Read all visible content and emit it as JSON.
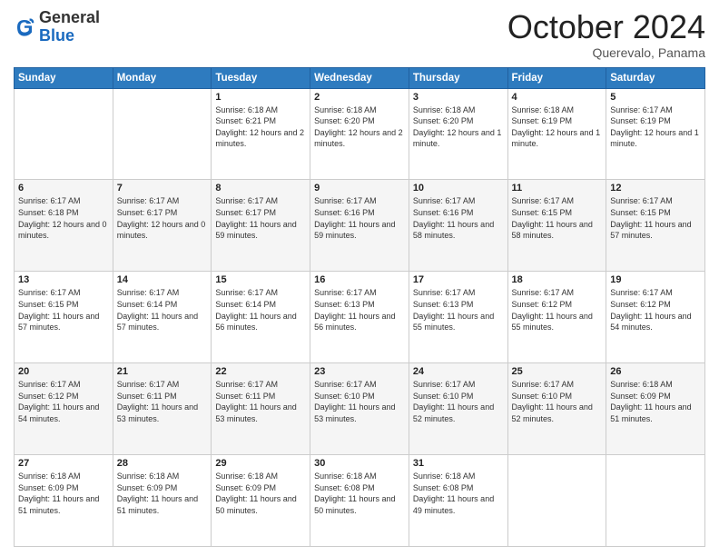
{
  "header": {
    "logo_general": "General",
    "logo_blue": "Blue",
    "month": "October 2024",
    "location": "Querevalo, Panama"
  },
  "days_of_week": [
    "Sunday",
    "Monday",
    "Tuesday",
    "Wednesday",
    "Thursday",
    "Friday",
    "Saturday"
  ],
  "weeks": [
    [
      {
        "day": "",
        "content": ""
      },
      {
        "day": "",
        "content": ""
      },
      {
        "day": "1",
        "content": "Sunrise: 6:18 AM\nSunset: 6:21 PM\nDaylight: 12 hours and 2 minutes."
      },
      {
        "day": "2",
        "content": "Sunrise: 6:18 AM\nSunset: 6:20 PM\nDaylight: 12 hours and 2 minutes."
      },
      {
        "day": "3",
        "content": "Sunrise: 6:18 AM\nSunset: 6:20 PM\nDaylight: 12 hours and 1 minute."
      },
      {
        "day": "4",
        "content": "Sunrise: 6:18 AM\nSunset: 6:19 PM\nDaylight: 12 hours and 1 minute."
      },
      {
        "day": "5",
        "content": "Sunrise: 6:17 AM\nSunset: 6:19 PM\nDaylight: 12 hours and 1 minute."
      }
    ],
    [
      {
        "day": "6",
        "content": "Sunrise: 6:17 AM\nSunset: 6:18 PM\nDaylight: 12 hours and 0 minutes."
      },
      {
        "day": "7",
        "content": "Sunrise: 6:17 AM\nSunset: 6:17 PM\nDaylight: 12 hours and 0 minutes."
      },
      {
        "day": "8",
        "content": "Sunrise: 6:17 AM\nSunset: 6:17 PM\nDaylight: 11 hours and 59 minutes."
      },
      {
        "day": "9",
        "content": "Sunrise: 6:17 AM\nSunset: 6:16 PM\nDaylight: 11 hours and 59 minutes."
      },
      {
        "day": "10",
        "content": "Sunrise: 6:17 AM\nSunset: 6:16 PM\nDaylight: 11 hours and 58 minutes."
      },
      {
        "day": "11",
        "content": "Sunrise: 6:17 AM\nSunset: 6:15 PM\nDaylight: 11 hours and 58 minutes."
      },
      {
        "day": "12",
        "content": "Sunrise: 6:17 AM\nSunset: 6:15 PM\nDaylight: 11 hours and 57 minutes."
      }
    ],
    [
      {
        "day": "13",
        "content": "Sunrise: 6:17 AM\nSunset: 6:15 PM\nDaylight: 11 hours and 57 minutes."
      },
      {
        "day": "14",
        "content": "Sunrise: 6:17 AM\nSunset: 6:14 PM\nDaylight: 11 hours and 57 minutes."
      },
      {
        "day": "15",
        "content": "Sunrise: 6:17 AM\nSunset: 6:14 PM\nDaylight: 11 hours and 56 minutes."
      },
      {
        "day": "16",
        "content": "Sunrise: 6:17 AM\nSunset: 6:13 PM\nDaylight: 11 hours and 56 minutes."
      },
      {
        "day": "17",
        "content": "Sunrise: 6:17 AM\nSunset: 6:13 PM\nDaylight: 11 hours and 55 minutes."
      },
      {
        "day": "18",
        "content": "Sunrise: 6:17 AM\nSunset: 6:12 PM\nDaylight: 11 hours and 55 minutes."
      },
      {
        "day": "19",
        "content": "Sunrise: 6:17 AM\nSunset: 6:12 PM\nDaylight: 11 hours and 54 minutes."
      }
    ],
    [
      {
        "day": "20",
        "content": "Sunrise: 6:17 AM\nSunset: 6:12 PM\nDaylight: 11 hours and 54 minutes."
      },
      {
        "day": "21",
        "content": "Sunrise: 6:17 AM\nSunset: 6:11 PM\nDaylight: 11 hours and 53 minutes."
      },
      {
        "day": "22",
        "content": "Sunrise: 6:17 AM\nSunset: 6:11 PM\nDaylight: 11 hours and 53 minutes."
      },
      {
        "day": "23",
        "content": "Sunrise: 6:17 AM\nSunset: 6:10 PM\nDaylight: 11 hours and 53 minutes."
      },
      {
        "day": "24",
        "content": "Sunrise: 6:17 AM\nSunset: 6:10 PM\nDaylight: 11 hours and 52 minutes."
      },
      {
        "day": "25",
        "content": "Sunrise: 6:17 AM\nSunset: 6:10 PM\nDaylight: 11 hours and 52 minutes."
      },
      {
        "day": "26",
        "content": "Sunrise: 6:18 AM\nSunset: 6:09 PM\nDaylight: 11 hours and 51 minutes."
      }
    ],
    [
      {
        "day": "27",
        "content": "Sunrise: 6:18 AM\nSunset: 6:09 PM\nDaylight: 11 hours and 51 minutes."
      },
      {
        "day": "28",
        "content": "Sunrise: 6:18 AM\nSunset: 6:09 PM\nDaylight: 11 hours and 51 minutes."
      },
      {
        "day": "29",
        "content": "Sunrise: 6:18 AM\nSunset: 6:09 PM\nDaylight: 11 hours and 50 minutes."
      },
      {
        "day": "30",
        "content": "Sunrise: 6:18 AM\nSunset: 6:08 PM\nDaylight: 11 hours and 50 minutes."
      },
      {
        "day": "31",
        "content": "Sunrise: 6:18 AM\nSunset: 6:08 PM\nDaylight: 11 hours and 49 minutes."
      },
      {
        "day": "",
        "content": ""
      },
      {
        "day": "",
        "content": ""
      }
    ]
  ]
}
